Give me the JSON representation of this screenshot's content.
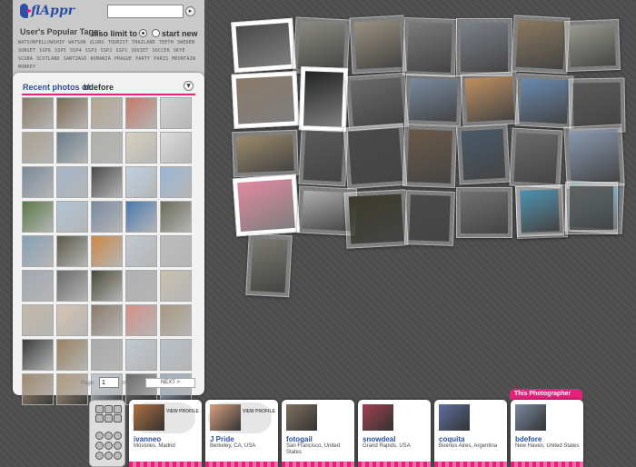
{
  "app": {
    "name": "flAppr"
  },
  "search": {
    "value": ""
  },
  "tags": {
    "title": "User's Popular Tags:",
    "also_limit": "also limit to",
    "start_new": "start new",
    "items": [
      "WATSONFELLOWSHIP",
      "WATSON",
      "ULURU",
      "TOURIST",
      "THAILAND",
      "TEETH",
      "SWEDEN",
      "SUNSET",
      "SSP6",
      "SSP5",
      "SSP4",
      "SSP3",
      "SSP2",
      "SSP1",
      "SOVIET",
      "SOCCER",
      "SKYE",
      "SCUBA",
      "SCOTLAND",
      "SANTIAGO",
      "ROMANIA",
      "PRAGUE",
      "PARTY",
      "PARIS",
      "MOUNTAIN",
      "MONKEY"
    ]
  },
  "recent": {
    "label": "Recent photos of:",
    "user": "bdefore"
  },
  "pagination": {
    "label": "Page:",
    "current": "1",
    "of": "of 5",
    "next": "NEXT >"
  },
  "thumbs": [
    "#8a7a66",
    "#7d6a55",
    "#b5a58f",
    "#c47a6a",
    "#d2d2d2",
    "#a9a090",
    "#6b7d8a",
    "#b0b0aa",
    "#d7d0c0",
    "#dcdcdc",
    "#7a8a9a",
    "#a3b4c8",
    "#4b4b4b",
    "#c0d0e0",
    "#9bb6d6",
    "#5a7a4a",
    "#b0c4d4",
    "#7a8aa0",
    "#4a7ab0",
    "#6a6a5a",
    "#86a0b4",
    "#5a5a4a",
    "#cc8844",
    "#c0c8d0",
    "#bcbcbc",
    "#a0a8b0",
    "#6a6a6a",
    "#4a4a3a",
    "#b0b0b0",
    "#c8c0b0",
    "#c4b8a8",
    "#d4c4b0",
    "#8a7a6a",
    "#d49088",
    "#a89880",
    "#3a3a3a",
    "#9a8060",
    "#aaaaaa",
    "#c0c8d0",
    "#b8c0c8",
    "#a08a70",
    "#b09a80",
    "#c0c8d0",
    "#6a6a6a",
    "#a0b0c0"
  ],
  "wall": {
    "photos": [
      {
        "color": "#4a4a4a",
        "solid": true
      },
      {
        "color": "#8a8a80"
      },
      {
        "color": "#9a9080"
      },
      {
        "color": "#7a7a7a"
      },
      {
        "color": "#7a8088"
      },
      {
        "color": "#8a7a60"
      },
      {
        "color": "#9a9a90"
      },
      {
        "color": "#8a7a6a",
        "solid": true
      },
      {
        "color": "#222222",
        "solid": true
      },
      {
        "color": "#6a6a6a"
      },
      {
        "color": "#7a8aa0"
      },
      {
        "color": "#c09060"
      },
      {
        "color": "#6a8ab0"
      },
      {
        "color": "#5a5a5a"
      },
      {
        "color": "#9a8a6a"
      },
      {
        "color": "#5a5a5a"
      },
      {
        "color": "#4a4a4a"
      },
      {
        "color": "#6a5a4a"
      },
      {
        "color": "#4a5a6a"
      },
      {
        "color": "#6a6a6a"
      },
      {
        "color": "#8a9ab0"
      },
      {
        "color": "#5aa0c0"
      },
      {
        "color": "#8a6a5a"
      },
      {
        "color": "#e08aa0",
        "solid": true
      },
      {
        "color": "#b0b0b0"
      },
      {
        "color": "#3a3a2a"
      },
      {
        "color": "#4a4a4a"
      },
      {
        "color": "#707070"
      },
      {
        "color": "#4a90b0"
      },
      {
        "color": "#7a7a70"
      },
      {
        "color": "#606060"
      }
    ]
  },
  "photographers": [
    {
      "name": "ivanneo",
      "location": "Móstoles, Madrid",
      "view": "VIEW PROFILE",
      "color": "#b07040"
    },
    {
      "name": "J Pride",
      "location": "Berkeley, CA, USA",
      "view": "VIEW PROFILE",
      "color": "#d8a080"
    },
    {
      "name": "fotogail",
      "location": "San Francisco, United States",
      "color": "#807060"
    },
    {
      "name": "snowdeal",
      "location": "Grand Rapids, USA",
      "color": "#a04050"
    },
    {
      "name": "coquita",
      "location": "Buenos Aires, Argentina",
      "color": "#6070a0"
    },
    {
      "name": "bdefore",
      "location": "New Haven, United States",
      "color": "#7a8aa0"
    }
  ],
  "this_photographer": "This Photographer",
  "colors": {
    "accent": "#e2227b",
    "brand": "#2b4ea0"
  }
}
